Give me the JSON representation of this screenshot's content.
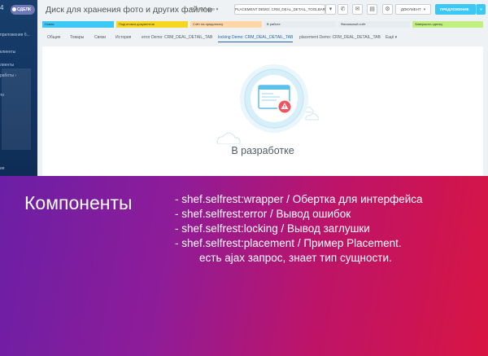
{
  "sidebar": {
    "badge_label": "СДЕЛК",
    "items": [
      "приложения б...",
      "клиенты",
      "лиенты",
      "работы ›",
      "то",
      "ия"
    ]
  },
  "window": {
    "title": "Диск для хранения фото и других файлов",
    "title_sub": "⚲ ⚙ Общие ▾",
    "placement_button": "PLACEMENT DEMO: CRM_DEAL_DETAIL_TOOLBAR",
    "document_button": "ДОКУМЕНТ",
    "proposal_button": "ПРЕДЛОЖЕНИЕ"
  },
  "stages": [
    {
      "label": "Новая",
      "color": "#3bc8f5"
    },
    {
      "label": "Подготовка документов",
      "color": "#f7d622"
    },
    {
      "label": "Счёт на предоплату",
      "color": "#ffd6a6"
    },
    {
      "label": "В работе",
      "color": "#e6ecef"
    },
    {
      "label": "Финальный счёт",
      "color": "#e6ecef"
    },
    {
      "label": "Завершить сделку",
      "color": "#c0f07d"
    }
  ],
  "tabs": [
    "Общие",
    "Товары",
    "Связи",
    "История",
    "error Demo: CRM_DEAL_DETAIL_TAB",
    "locking Demo: CRM_DEAL_DETAIL_TAB",
    "placement Demo: CRM_DEAL_DETAIL_TAB",
    "Ещё ▾"
  ],
  "active_tab_index": 5,
  "content": {
    "status_text": "В разработке"
  },
  "banner": {
    "title": "Компоненты",
    "items": [
      "- shef.selfrest:wrapper / Обертка для интерфейса",
      "- shef.selfrest:error / Вывод ошибок",
      "- shef.selfrest:locking / Вывод заглушки",
      "- shef.selfrest:placement / Пример Placement.",
      "есть ajax запрос, знает тип сущности."
    ]
  }
}
